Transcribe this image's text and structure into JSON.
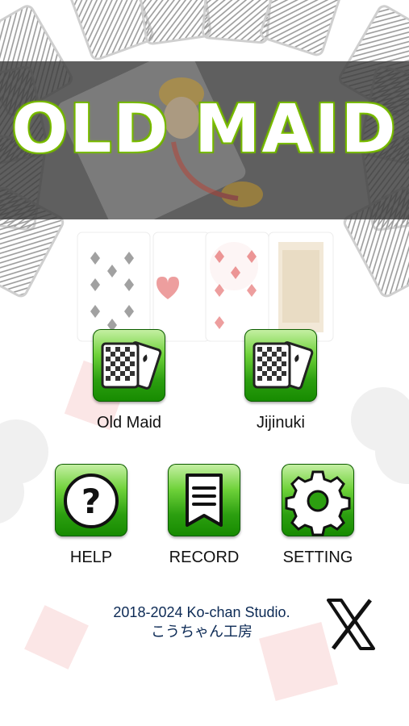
{
  "title": "OLD MAID",
  "menu": {
    "old_maid": "Old Maid",
    "jijinuki": "Jijinuki",
    "help": "HELP",
    "record": "RECORD",
    "setting": "SETTING"
  },
  "footer": {
    "copyright": "2018-2024 Ko-chan Studio.",
    "studio_jp": "こうちゃん工房"
  },
  "icons": {
    "old_maid": "card-deck-icon",
    "jijinuki": "card-deck-icon",
    "help": "question-icon",
    "record": "record-icon",
    "setting": "gear-icon",
    "social": "x-logo-icon"
  },
  "colors": {
    "button_green": "#2c9f10",
    "title_outline": "#8bd000",
    "footer_text": "#0c2a55"
  }
}
